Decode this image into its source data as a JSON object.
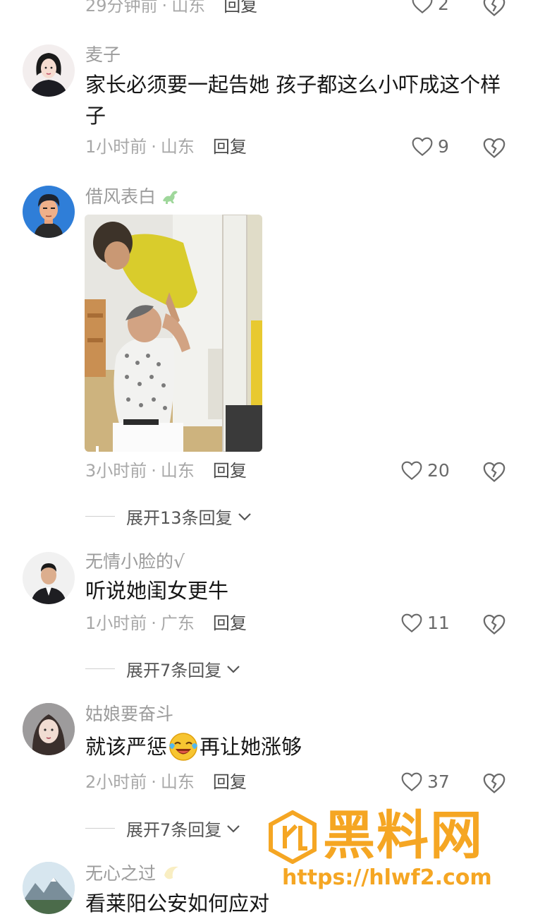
{
  "comments": [
    {
      "time": "29分钟前",
      "region": "山东",
      "reply": "回复",
      "likes": "2"
    },
    {
      "name": "麦子",
      "text": "家长必须要一起告她 孩子都这么小吓成这个样子",
      "time": "1小时前",
      "region": "山东",
      "reply": "回复",
      "likes": "9"
    },
    {
      "name": "借风表白",
      "time": "3小时前",
      "region": "山东",
      "reply": "回复",
      "likes": "20",
      "expand": "展开13条回复"
    },
    {
      "name": "无情小脸的√",
      "text": "听说她闺女更牛",
      "time": "1小时前",
      "region": "广东",
      "reply": "回复",
      "likes": "11",
      "expand": "展开7条回复"
    },
    {
      "name": "姑娘要奋斗",
      "text_a": "就该严惩",
      "text_b": "再让她涨够",
      "time": "2小时前",
      "region": "山东",
      "reply": "回复",
      "likes": "37",
      "expand": "展开7条回复"
    },
    {
      "name": "无心之过",
      "text": "看莱阳公安如何应对"
    }
  ],
  "watermark": {
    "title": "黑料网",
    "url": "https://hlwf2.com"
  },
  "colors": {
    "accent_watermark": "#f5a623"
  }
}
